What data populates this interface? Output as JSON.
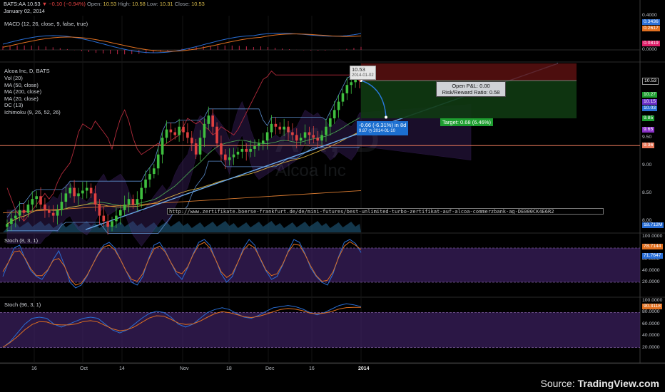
{
  "header": {
    "symbol": "BATS:AA",
    "last": "10.53",
    "change": "▼ −0.10 (−0.94%)",
    "open_label": "Open:",
    "open": "10.53",
    "high_label": "High:",
    "high": "10.58",
    "low_label": "Low:",
    "low": "10.31",
    "close_label": "Close:",
    "close": "10.53",
    "date": "January 02, 2014"
  },
  "panes": {
    "macd_label": "MACD (12, 26, close, 9, false, true)",
    "main_label": "Alcoa Inc, D, BATS",
    "indicators": [
      "Vol (20)",
      "MA (50, close)",
      "MA (200, close)",
      "MA (20, close)",
      "DC (13)",
      "Ichimoku (9, 26, 52, 26)"
    ],
    "stoch1_label": "Stoch (8, 3, 1)",
    "stoch2_label": "Stoch (96, 3, 1)"
  },
  "annotations": {
    "url": "http://www.zertifikate.boerse-frankfurt.de/de/mini-futures/best-unlimited-turbo-zertifikat-auf-alcoa-commerzbank-ag-DE000CK4E6R2",
    "pnl_line1": "Open P&L: 0.00",
    "pnl_line2": "Risk/Reward Ratio: 0.58",
    "target": "Target: 0.68 (6.46%)",
    "stop_line1": "-0.66 (-6.31%) in 8d",
    "stop_line2": "9.87  ◷ 2014-01-10",
    "price_tag": "10.53",
    "price_tag_date": "2014-01-02",
    "watermark_symbol": "AA, D",
    "watermark_name": "Alcoa Inc",
    "source_label": "Source: ",
    "source_brand": "TradingView.com"
  },
  "axes": {
    "macd_ticks": [
      "0.4000",
      "0.0000"
    ],
    "macd_badges": [
      {
        "text": "0.3436",
        "color": "#2a6fd6"
      },
      {
        "text": "0.2617",
        "color": "#e07020"
      },
      {
        "text": "0.0819",
        "color": "#e0206a"
      }
    ],
    "price_ticks": [
      "10.00",
      "9.50",
      "9.00",
      "8.50",
      "8.00"
    ],
    "price_badges": [
      {
        "text": "10.53",
        "color": "#000000",
        "border": "#999999",
        "value": 10.53
      },
      {
        "text": "10.27",
        "color": "#1e9e30",
        "value": 10.27
      },
      {
        "text": "10.15",
        "color": "#6a30c8",
        "value": 10.15
      },
      {
        "text": "10.03",
        "color": "#2a6fd6",
        "value": 10.03
      },
      {
        "text": "9.85",
        "color": "#1e9e30",
        "value": 9.85
      },
      {
        "text": "9.65",
        "color": "#8a30c8",
        "value": 9.65
      },
      {
        "text": "9.36",
        "color": "#e8785a",
        "value": 9.36
      }
    ],
    "volume_badge": "18.712M",
    "stoch_ticks": [
      "100.0000",
      "80.0000",
      "60.0000",
      "40.0000",
      "20.0000"
    ],
    "stoch1_badges": [
      {
        "text": "78.7144",
        "color": "#e07020"
      },
      {
        "text": "71.7647",
        "color": "#2a6fd6"
      }
    ],
    "stoch2_badges": [
      {
        "text": "90.3118",
        "color": "#e07020"
      }
    ],
    "x_labels": [
      {
        "text": "16",
        "bold": false
      },
      {
        "text": "Oct",
        "bold": false
      },
      {
        "text": "14",
        "bold": false
      },
      {
        "text": "Nov",
        "bold": false
      },
      {
        "text": "18",
        "bold": false
      },
      {
        "text": "Dec",
        "bold": false
      },
      {
        "text": "16",
        "bold": false
      },
      {
        "text": "2014",
        "bold": true
      }
    ]
  },
  "colors": {
    "up": "#3fbf3f",
    "down": "#e04040",
    "macd": "#2a6fd6",
    "signal": "#e07020",
    "hist": "#c0284a",
    "stoch_k": "#2a6fd6",
    "stoch_d": "#e07020",
    "band": "#3a1f5c"
  },
  "chart_data": {
    "type": "candlestick",
    "title": "Alcoa Inc, D, BATS",
    "ylim": [
      7.8,
      10.85
    ],
    "horizontal_levels": [
      9.36
    ],
    "target": 10.27,
    "entry": 10.53,
    "stop": 9.87,
    "close_series_approx": [
      7.95,
      8.05,
      8.1,
      8.2,
      8.15,
      8.3,
      8.4,
      8.45,
      8.3,
      8.2,
      8.15,
      8.1,
      8.2,
      8.35,
      8.5,
      8.6,
      8.45,
      8.5,
      8.55,
      8.6,
      8.5,
      8.3,
      8.1,
      8.0,
      7.9,
      8.0,
      8.1,
      8.2,
      8.3,
      8.4,
      8.3,
      8.4,
      8.6,
      8.75,
      8.85,
      8.95,
      9.2,
      9.5,
      9.65,
      9.6,
      9.55,
      9.7,
      9.6,
      9.5,
      9.4,
      9.2,
      9.5,
      9.75,
      9.9,
      9.7,
      9.4,
      9.2,
      9.1,
      9.15,
      9.2,
      9.25,
      9.3,
      9.25,
      9.3,
      9.35,
      9.4,
      9.45,
      9.6,
      9.75,
      9.7,
      9.65,
      9.7,
      9.6,
      9.55,
      9.45,
      9.5,
      9.6,
      9.55,
      9.5,
      9.45,
      9.55,
      9.7,
      9.85,
      10.0,
      10.15,
      10.3,
      10.45,
      10.5,
      10.6,
      10.53
    ],
    "stoch_fast_approx": [
      30,
      55,
      80,
      85,
      60,
      40,
      30,
      25,
      40,
      60,
      75,
      50,
      20,
      10,
      15,
      30,
      50,
      70,
      85,
      90,
      80,
      60,
      40,
      20,
      15,
      30,
      60,
      85,
      90,
      75,
      55,
      35,
      25,
      45,
      70,
      90,
      95,
      85,
      60,
      35,
      20,
      30,
      55,
      80,
      95,
      85,
      60,
      40,
      25,
      30,
      50,
      75,
      95,
      90,
      70,
      45,
      30,
      20,
      15,
      35,
      65,
      90,
      95,
      88,
      72
    ],
    "stoch_slow_approx": [
      20,
      30,
      45,
      60,
      70,
      72,
      70,
      60,
      55,
      60,
      65,
      70,
      72,
      70,
      60,
      50,
      45,
      50,
      60,
      70,
      78,
      82,
      80,
      72,
      60,
      55,
      60,
      70,
      80,
      85,
      88,
      85,
      78,
      72,
      70,
      75,
      82,
      88,
      90,
      92,
      90,
      86,
      80,
      76,
      80,
      86,
      92,
      95,
      93,
      90
    ]
  }
}
